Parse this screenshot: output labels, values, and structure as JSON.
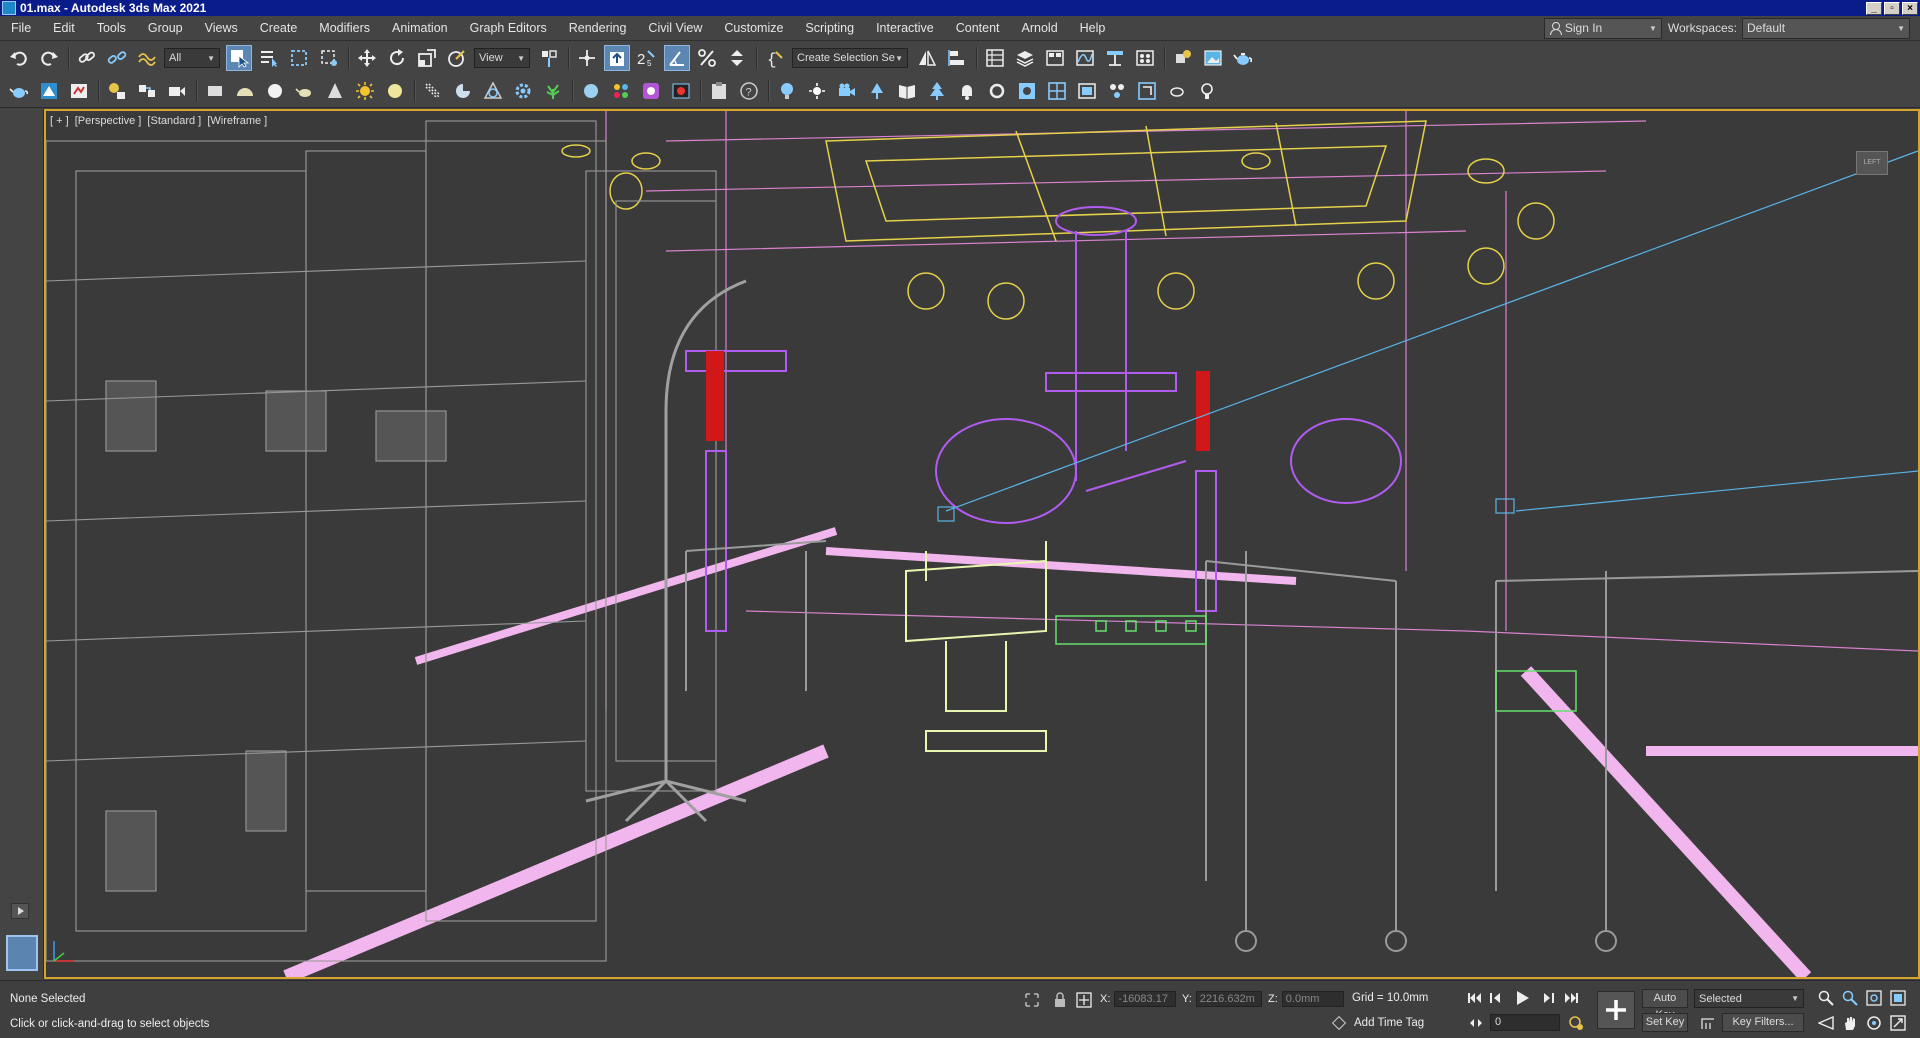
{
  "titlebar": {
    "title": "01.max - Autodesk 3ds Max 2021",
    "minimize": "_",
    "maximize": "▫",
    "close": "×"
  },
  "menus": [
    "File",
    "Edit",
    "Tools",
    "Group",
    "Views",
    "Create",
    "Modifiers",
    "Animation",
    "Graph Editors",
    "Rendering",
    "Civil View",
    "Customize",
    "Scripting",
    "Interactive",
    "Content",
    "Arnold",
    "Help"
  ],
  "account": {
    "signin_label": "Sign In",
    "workspaces_label": "Workspaces:",
    "workspace_value": "Default"
  },
  "toolbar": {
    "selection_filter": "All",
    "reference_coord": "View",
    "snap_label": "2",
    "snap_sub": "5",
    "named_selection_set": "Create Selection Se"
  },
  "viewport": {
    "labels": [
      "[ + ]",
      "[Perspective ]",
      "[Standard ]",
      "[Wireframe ]"
    ],
    "viewcube_label": "LEFT"
  },
  "status": {
    "selection": "None Selected",
    "prompt": "Click or click-and-drag to select objects",
    "x_label": "X:",
    "x_value": "-16083.17",
    "y_label": "Y:",
    "y_value": "2216.632m",
    "z_label": "Z:",
    "z_value": "0.0mm",
    "grid": "Grid = 10.0mm",
    "add_time_tag": "Add Time Tag",
    "frame": "0",
    "auto_key": "Auto Key",
    "set_key": "Set Key",
    "selected_set": "Selected",
    "key_filters": "Key Filters..."
  },
  "colors": {
    "titlebar": "#0a1c8a",
    "ui_background": "#444444",
    "viewport_background": "#3a3a3a",
    "viewport_border": "#d6a32c",
    "active_button": "#5c87b3"
  }
}
